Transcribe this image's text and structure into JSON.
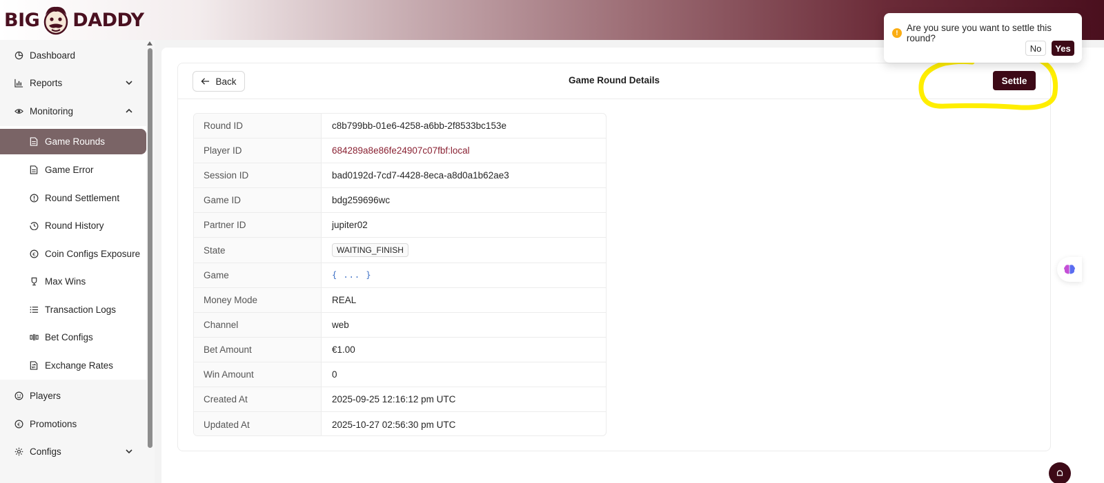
{
  "brand": {
    "logo_left": "BIG",
    "logo_right": "DADDY",
    "primary_color": "#3d0a17",
    "active_nav_color": "#7a6466",
    "highlight_color": "#ffee00"
  },
  "sidebar": {
    "items": [
      {
        "label": "Dashboard",
        "icon": "dashboard-icon"
      },
      {
        "label": "Reports",
        "icon": "bar-chart-icon",
        "chevron": "down"
      },
      {
        "label": "Monitoring",
        "icon": "eye-icon",
        "chevron": "up"
      },
      {
        "label": "Game Rounds",
        "icon": "file-icon",
        "active": true
      },
      {
        "label": "Game Error",
        "icon": "file-icon"
      },
      {
        "label": "Round Settlement",
        "icon": "alert-circle-icon"
      },
      {
        "label": "Round History",
        "icon": "history-icon"
      },
      {
        "label": "Coin Configs Exposure",
        "icon": "euro-circle-icon"
      },
      {
        "label": "Max Wins",
        "icon": "trophy-icon"
      },
      {
        "label": "Transaction Logs",
        "icon": "list-icon"
      },
      {
        "label": "Bet Configs",
        "icon": "sliders-icon"
      },
      {
        "label": "Exchange Rates",
        "icon": "exchange-icon"
      },
      {
        "label": "Players",
        "icon": "smile-icon"
      },
      {
        "label": "Promotions",
        "icon": "euro-circle-icon"
      },
      {
        "label": "Configs",
        "icon": "gear-icon",
        "chevron": "down"
      }
    ]
  },
  "card": {
    "back_label": "Back",
    "title": "Game Round Details",
    "settle_label": "Settle"
  },
  "details": [
    {
      "key": "Round ID",
      "value": "c8b799bb-01e6-4258-a6bb-2f8533bc153e"
    },
    {
      "key": "Player ID",
      "value": "684289a8e86fe24907c07fbf:local",
      "type": "link"
    },
    {
      "key": "Session ID",
      "value": "bad0192d-7cd7-4428-8eca-a8d0a1b62ae3"
    },
    {
      "key": "Game ID",
      "value": "bdg259696wc"
    },
    {
      "key": "Partner ID",
      "value": "jupiter02"
    },
    {
      "key": "State",
      "value": "WAITING_FINISH",
      "type": "tag"
    },
    {
      "key": "Game",
      "value": "{ ... }",
      "type": "json"
    },
    {
      "key": "Money Mode",
      "value": "REAL"
    },
    {
      "key": "Channel",
      "value": "web"
    },
    {
      "key": "Bet Amount",
      "value": "€1.00"
    },
    {
      "key": "Win Amount",
      "value": "0"
    },
    {
      "key": "Created At",
      "value": "2025-09-25 12:16:12 pm UTC"
    },
    {
      "key": "Updated At",
      "value": "2025-10-27 02:56:30 pm UTC"
    }
  ],
  "popconfirm": {
    "message": "Are you sure you want to settle this round?",
    "no_label": "No",
    "yes_label": "Yes",
    "icon": "warning-icon"
  }
}
